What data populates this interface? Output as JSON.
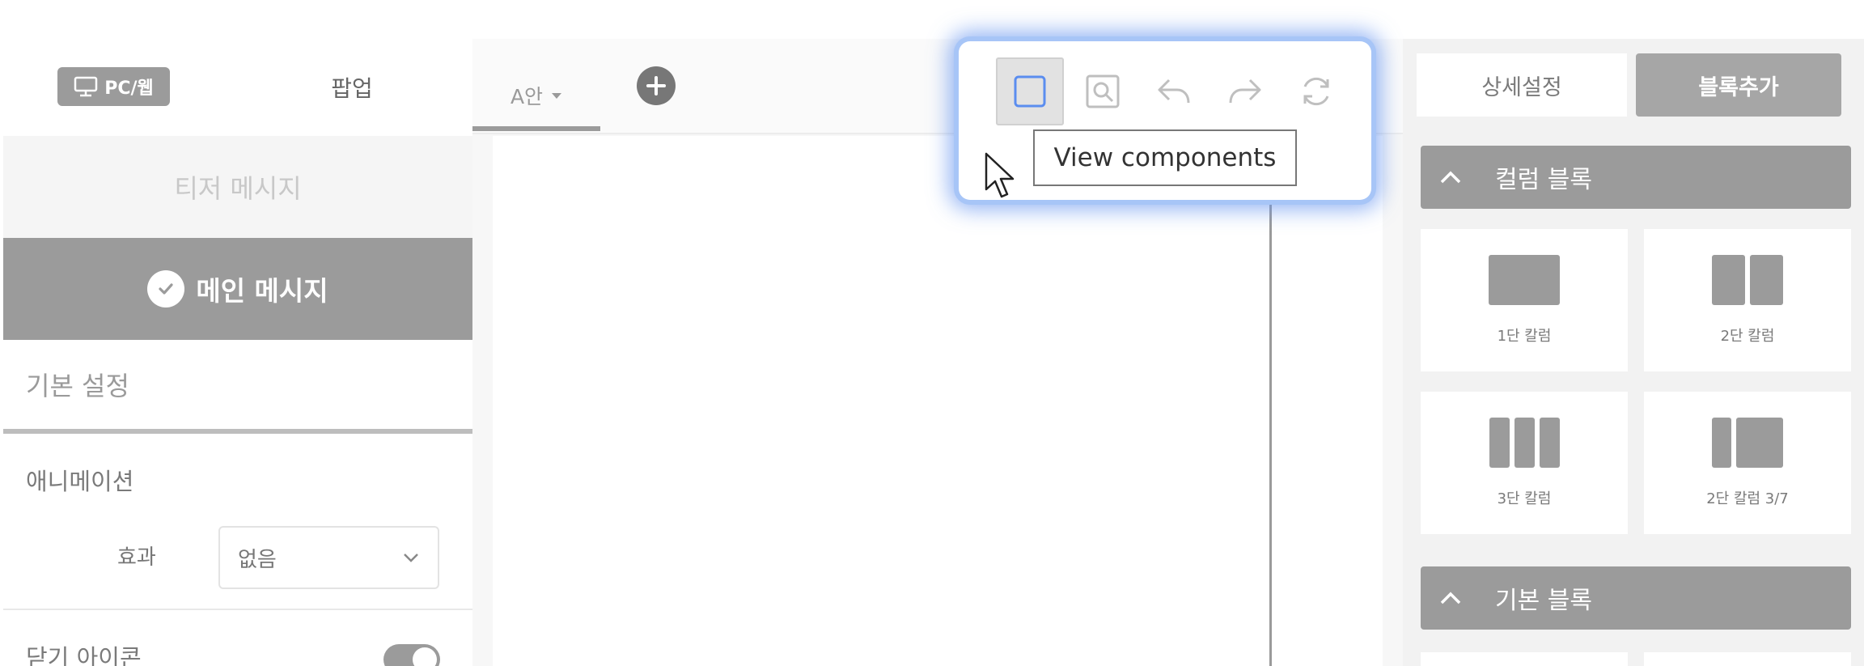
{
  "left_panel": {
    "mode_label": "PC/웹",
    "popup_tab": "팝업",
    "teaser_message": "티저 메시지",
    "main_message": "메인 메시지",
    "basic_settings": "기본 설정",
    "animation_section": "애니메이션",
    "effect_label": "효과",
    "effect_value": "없음",
    "close_icon_label": "닫기 아이콘",
    "close_icon_toggle": true
  },
  "canvas": {
    "variant_tab": "A안",
    "toolbar": {
      "buttons": [
        "view-components",
        "preview",
        "undo",
        "redo",
        "refresh"
      ],
      "active": "view-components",
      "tooltip": "View components"
    }
  },
  "right_panel": {
    "tabs": [
      "상세설정",
      "블록추가"
    ],
    "active_tab": "블록추가",
    "groups": [
      {
        "title": "컬럼 블록",
        "blocks": [
          "1단 칼럼",
          "2단 칼럼",
          "3단 칼럼",
          "2단 칼럼 3/7"
        ]
      },
      {
        "title": "기본 블록",
        "blocks": []
      }
    ]
  },
  "colors": {
    "accent_gray": "#9b9b9b",
    "highlight_blue": "#a7c5f7",
    "active_icon_blue": "#5b8def"
  }
}
